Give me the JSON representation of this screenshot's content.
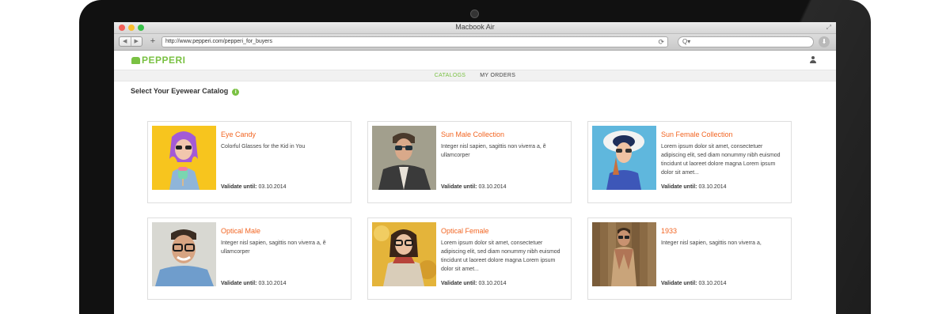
{
  "window": {
    "title": "Macbook Air"
  },
  "browser": {
    "url": "http://www.pepperi.com/pepperi_for_buyers",
    "search_placeholder": "Q▾",
    "back_label": "◀",
    "forward_label": "▶",
    "add_tab_label": "+",
    "reload_icon": "⟳",
    "download_icon": "⬇",
    "resize_icon": "⤢"
  },
  "app": {
    "brand": "PEPPERI",
    "nav": {
      "catalogs": "CATALOGS",
      "orders": "MY ORDERS"
    },
    "page_title": "Select Your Eyewear Catalog",
    "info_icon": "i"
  },
  "catalogs": [
    {
      "title": "Eye Candy",
      "desc": "Colorful Glasses for the Kid in You",
      "validate_label": "Validate until:",
      "date": "03.10.2014"
    },
    {
      "title": "Sun Male Collection",
      "desc": "Integer nisl sapien, sagittis non viverra a, ẽ ullamcorper",
      "validate_label": "Validate until:",
      "date": "03.10.2014"
    },
    {
      "title": "Sun Female Collection",
      "desc": "Lorem ipsum dolor sit amet, consectetuer adipiscing elit, sed diam nonummy nibh euismod tincidunt ut laoreet dolore magna Lorem ipsum dolor sit amet...",
      "validate_label": "Validate until:",
      "date": "03.10.2014"
    },
    {
      "title": "Optical Male",
      "desc": "Integer nisl sapien, sagittis non viverra a, ẽ ullamcorper",
      "validate_label": "Validate until:",
      "date": "03.10.2014"
    },
    {
      "title": "Optical Female",
      "desc": "Lorem ipsum dolor sit amet, consectetuer adipiscing elit, sed diam nonummy nibh euismod tincidunt ut laoreet dolore magna Lorem ipsum dolor sit amet...",
      "validate_label": "Validate until:",
      "date": "03.10.2014"
    },
    {
      "title": "1933",
      "desc": "Integer nisl sapien, sagittis non viverra a,",
      "validate_label": "Validate until:",
      "date": "03.10.2014"
    }
  ],
  "colors": {
    "accent": "#7ac143",
    "title": "#f26522"
  }
}
